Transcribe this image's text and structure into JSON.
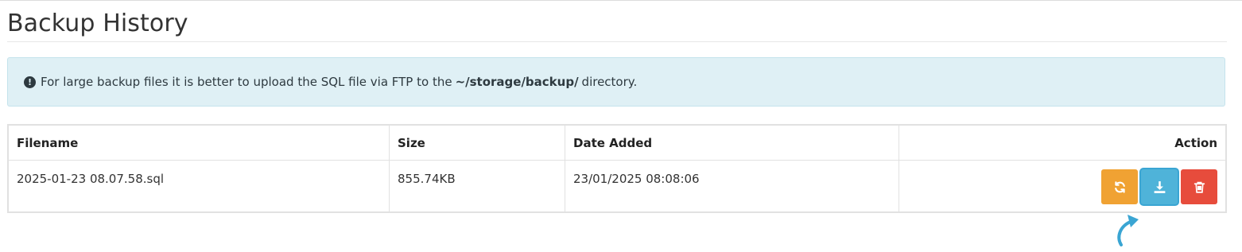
{
  "page": {
    "title": "Backup History"
  },
  "alert": {
    "text_before": "For large backup files it is better to upload the SQL file via FTP to the",
    "path": "~/storage/backup/",
    "text_after": "directory."
  },
  "table": {
    "headers": {
      "filename": "Filename",
      "size": "Size",
      "date_added": "Date Added",
      "action": "Action"
    },
    "rows": [
      {
        "filename": "2025-01-23 08.07.58.sql",
        "size": "855.74KB",
        "date_added": "23/01/2025 08:08:06"
      }
    ]
  },
  "actions": {
    "restore_icon": "refresh-icon",
    "download_icon": "download-icon",
    "delete_icon": "trash-icon"
  },
  "colors": {
    "restore": "#f0a233",
    "download": "#4fb3d9",
    "delete": "#e74c3c",
    "alert_bg": "#dff0f5",
    "annotation_arrow": "#3aa5d3"
  }
}
